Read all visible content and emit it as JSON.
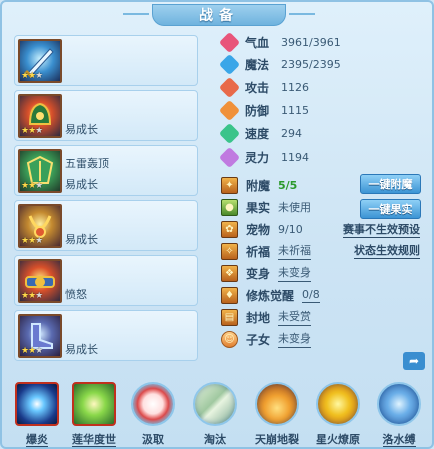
{
  "window": {
    "title": "战备"
  },
  "equipment": [
    {
      "name_top": "",
      "name_bottom": "",
      "stars_filled": 2,
      "stars_total": 3,
      "icon": "sword-icon",
      "style": "blue"
    },
    {
      "name_top": "",
      "name_bottom": "易成长",
      "stars_filled": 2,
      "stars_total": 3,
      "icon": "helmet-icon",
      "style": "red"
    },
    {
      "name_top": "五雷轰顶",
      "name_bottom": "易成长",
      "stars_filled": 2,
      "stars_total": 3,
      "icon": "armor-icon",
      "style": "green"
    },
    {
      "name_top": "",
      "name_bottom": "易成长",
      "stars_filled": 2,
      "stars_total": 3,
      "icon": "necklace-icon",
      "style": "gold"
    },
    {
      "name_top": "",
      "name_bottom": "愤怒",
      "stars_filled": 2,
      "stars_total": 3,
      "icon": "belt-icon",
      "style": "red"
    },
    {
      "name_top": "",
      "name_bottom": "易成长",
      "stars_filled": 2,
      "stars_total": 3,
      "icon": "boots-icon",
      "style": "purple"
    }
  ],
  "stats": [
    {
      "label": "气血",
      "value": "3961/3961",
      "icon": "heart-icon",
      "color": "#e8557a"
    },
    {
      "label": "魔法",
      "value": "2395/2395",
      "icon": "mana-icon",
      "color": "#3aa6e8"
    },
    {
      "label": "攻击",
      "value": "1126",
      "icon": "attack-icon",
      "color": "#e86a4a"
    },
    {
      "label": "防御",
      "value": "1115",
      "icon": "defense-icon",
      "color": "#f0913a"
    },
    {
      "label": "速度",
      "value": "294",
      "icon": "speed-icon",
      "color": "#3ac48a"
    },
    {
      "label": "灵力",
      "value": "1194",
      "icon": "spirit-icon",
      "color": "#c07ae0"
    }
  ],
  "items": [
    {
      "label": "附魔",
      "value": "5/5",
      "style": "green",
      "icon": "enchant-icon",
      "shape": "sq"
    },
    {
      "label": "果实",
      "value": "未使用",
      "style": "",
      "icon": "fruit-icon",
      "shape": "green"
    },
    {
      "label": "宠物",
      "value": "9/10",
      "style": "",
      "icon": "pet-icon",
      "shape": "sq"
    },
    {
      "label": "祈福",
      "value": "未祈福",
      "style": "ul",
      "icon": "blessing-icon",
      "shape": "sq"
    },
    {
      "label": "变身",
      "value": "未变身",
      "style": "ul",
      "icon": "transform-icon",
      "shape": "sq"
    },
    {
      "label": "修炼觉醒",
      "value": "0/8",
      "style": "ul",
      "icon": "cultivation-icon",
      "shape": "sq"
    },
    {
      "label": "封地",
      "value": "未受赏",
      "style": "ul",
      "icon": "fief-icon",
      "shape": "sq"
    },
    {
      "label": "子女",
      "value": "未变身",
      "style": "ul",
      "icon": "children-icon",
      "shape": "round"
    }
  ],
  "buttons": {
    "enchant": "一键附魔",
    "fruit": "一键果实"
  },
  "links": {
    "preset": "赛事不生效预设",
    "rules": "状态生效规则"
  },
  "skills": [
    {
      "name": "爆炎",
      "icon": "blast-fire-icon",
      "shape": "square",
      "underline": true,
      "color": "#2a5fbf"
    },
    {
      "name": "莲华度世",
      "icon": "lotus-hand-icon",
      "shape": "square",
      "underline": true,
      "color": "#6ec23a"
    },
    {
      "name": "汲取",
      "icon": "absorb-icon",
      "shape": "circle",
      "underline": false,
      "color": "#e06060"
    },
    {
      "name": "淘汰",
      "icon": "eliminate-icon",
      "shape": "circle",
      "underline": false,
      "color": "#a0c8a0"
    },
    {
      "name": "天崩地裂",
      "icon": "earthquake-icon",
      "shape": "circle",
      "underline": false,
      "color": "#f0a030"
    },
    {
      "name": "星火燎原",
      "icon": "starfire-icon",
      "shape": "circle",
      "underline": false,
      "color": "#f0c020"
    },
    {
      "name": "洛水缚",
      "icon": "water-bind-icon",
      "shape": "circle",
      "underline": true,
      "color": "#4a8ad0"
    }
  ]
}
